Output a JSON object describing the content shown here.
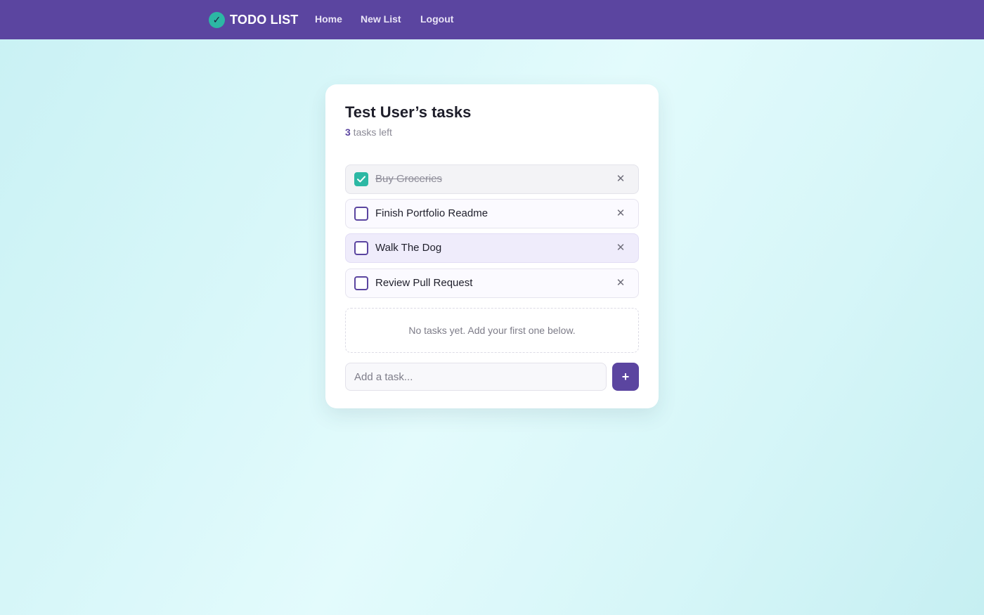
{
  "nav": {
    "brand_icon": "check-icon",
    "brand_icon_glyph": "✓",
    "brand": "TODO LIST",
    "links": [
      {
        "label": "Home"
      },
      {
        "label": "New List"
      },
      {
        "label": "Logout"
      }
    ]
  },
  "card": {
    "title": "Test User’s tasks",
    "count": "3",
    "count_suffix": " tasks left"
  },
  "tasks": [
    {
      "label": "Buy Groceries",
      "done": true,
      "delete_glyph": "✕"
    },
    {
      "label": "Finish Portfolio Readme",
      "done": false,
      "delete_glyph": "✕"
    },
    {
      "label": "Walk The Dog",
      "done": false,
      "delete_glyph": "✕"
    },
    {
      "label": "Review Pull Request",
      "done": false,
      "delete_glyph": "✕"
    }
  ],
  "empty_message": "No tasks yet. Add your first one below.",
  "add_form": {
    "value": "",
    "placeholder": "Add a task...",
    "button_label": "+"
  },
  "colors": {
    "primary": "#5b45a0",
    "accent": "#2cb8a4",
    "background": "#d8f7f9"
  }
}
